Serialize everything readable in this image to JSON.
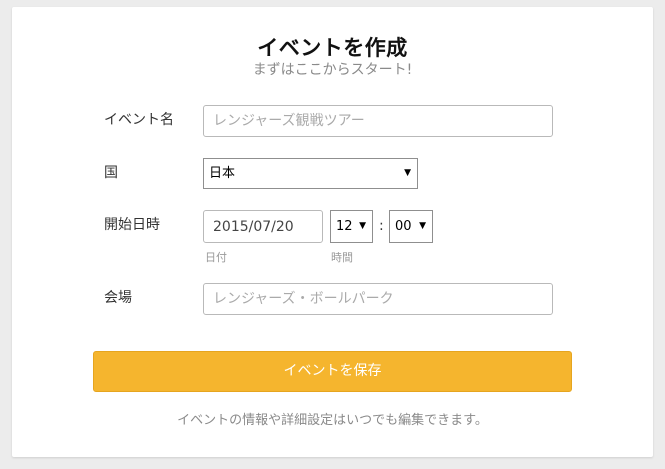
{
  "header": {
    "title": "イベントを作成",
    "subtitle": "まずはここからスタート!"
  },
  "form": {
    "event_name": {
      "label": "イベント名",
      "placeholder": "レンジャーズ観戦ツアー",
      "value": ""
    },
    "country": {
      "label": "国",
      "selected": "日本"
    },
    "start_datetime": {
      "label": "開始日時",
      "date_value": "2015/07/20",
      "date_hint": "日付",
      "hour_selected": "12",
      "minute_selected": "00",
      "time_hint": "時間",
      "separator": ":"
    },
    "venue": {
      "label": "会場",
      "placeholder": "レンジャーズ・ボールパーク",
      "value": ""
    },
    "submit_label": "イベントを保存",
    "footnote": "イベントの情報や詳細設定はいつでも編集できます。"
  },
  "colors": {
    "accent": "#f5b52e",
    "background": "#ececec",
    "card": "#ffffff"
  },
  "icons": {
    "select_arrow": "triangle-down-icon"
  }
}
